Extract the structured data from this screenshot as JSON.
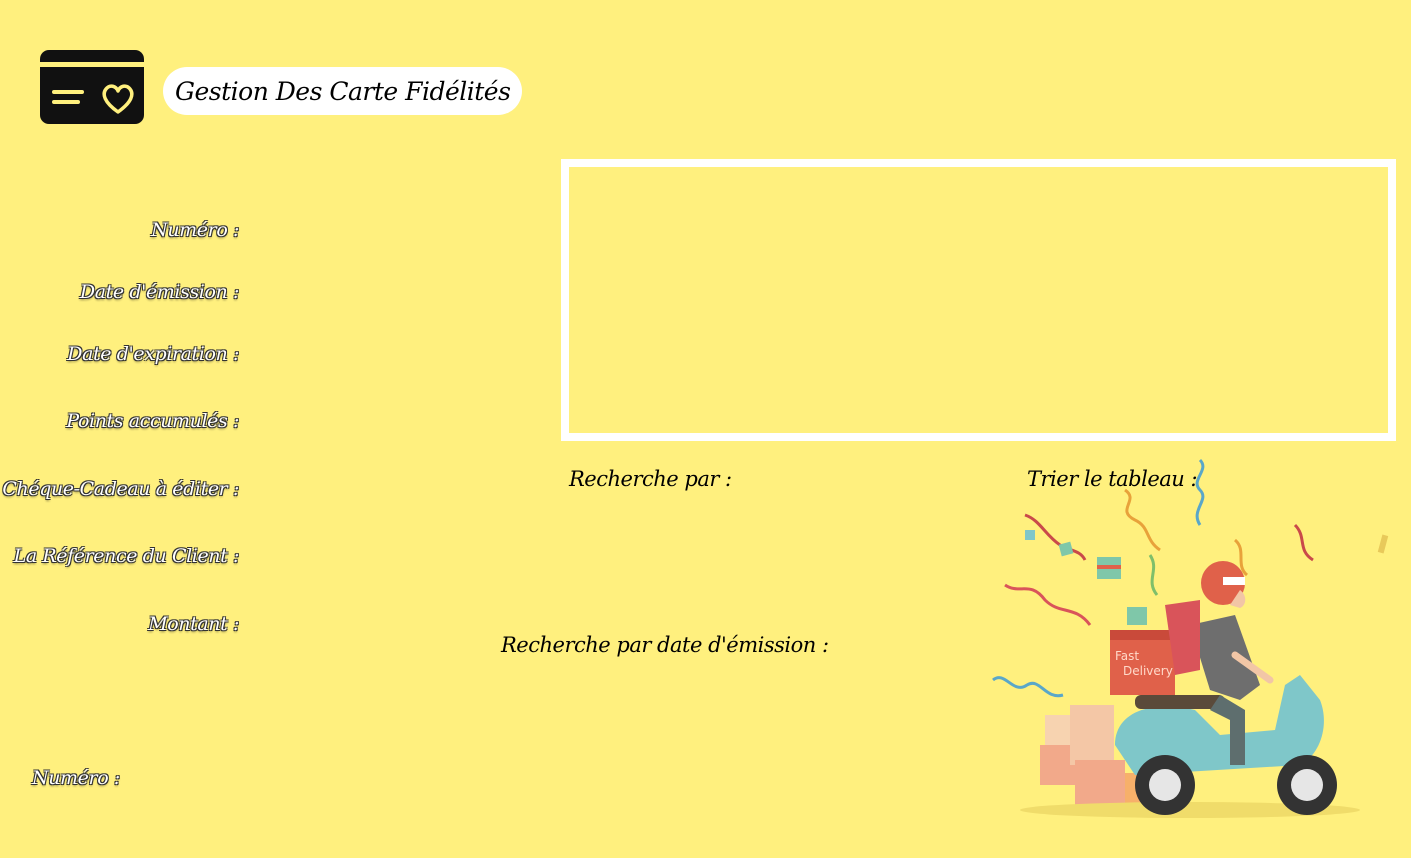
{
  "header": {
    "title": "Gestion Des Carte Fidélités",
    "logo_icon": "loyalty-card-heart-icon"
  },
  "form": {
    "labels": {
      "numero": "Numéro :",
      "date_emission": "Date d'émission :",
      "date_expiration": "Date d'expiration :",
      "points": "Points accumulés :",
      "cheque": "Chéque-Cadeau à éditer :",
      "reference_client": "La Référence du Client :",
      "montant": "Montant :"
    },
    "bottom_numero": "Numéro :"
  },
  "search": {
    "recherche_par": "Recherche par :",
    "trier": "Trier le tableau :",
    "recherche_date": "Recherche par date d'émission :"
  },
  "illustration": {
    "icon": "delivery-scooter-illustration",
    "box_text_line1": "Fast",
    "box_text_line2": "Delivery"
  },
  "colors": {
    "background": "#fff07e",
    "frame": "#ffffff",
    "scooter": "#7fc7c9",
    "delivery_box": "#e0614a",
    "helmet": "#e0614a"
  }
}
